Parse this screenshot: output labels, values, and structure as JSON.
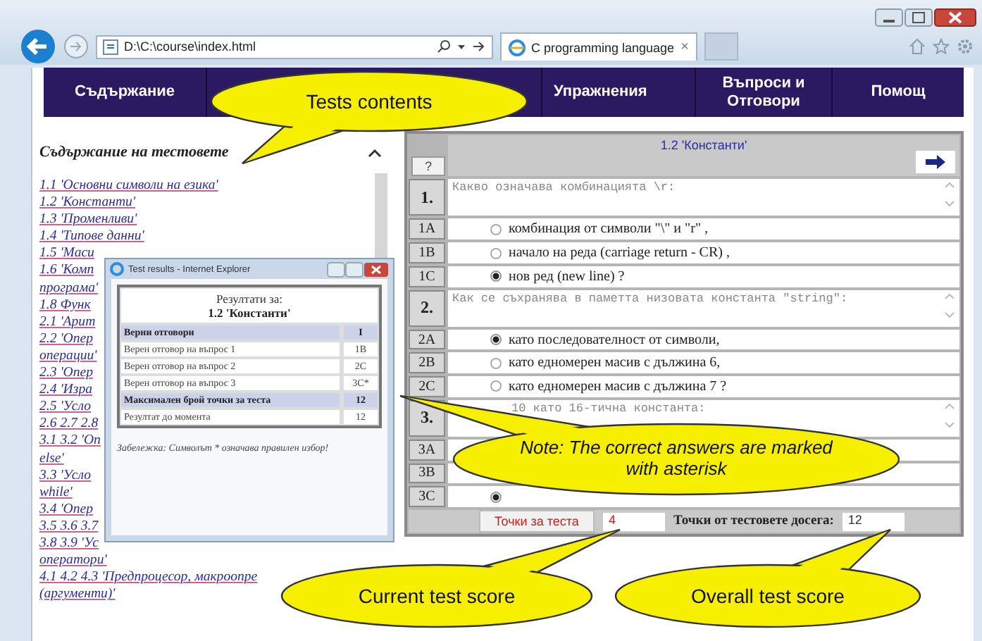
{
  "browser": {
    "address": "D:\\C:\\course\\index.html",
    "tab_title": "C programming language",
    "tab_close": "×"
  },
  "nav": {
    "items": [
      {
        "label": "Съдържание"
      },
      {
        "label": "Упражнения"
      },
      {
        "label": "Въпроси и Отговори"
      },
      {
        "label": "Помощ"
      }
    ]
  },
  "contents": {
    "heading": "Съдържание на тестовете",
    "links": [
      {
        "lines": [
          "1.1 'Основни символи на езика'"
        ]
      },
      {
        "lines": [
          "1.2 'Константи'"
        ]
      },
      {
        "lines": [
          "1.3 'Променливи'"
        ]
      },
      {
        "lines": [
          "1.4 'Типове данни'"
        ]
      },
      {
        "lines": [
          "1.5 'Маси"
        ]
      },
      {
        "lines": [
          "1.6 'Комп",
          "програма'"
        ]
      },
      {
        "lines": [
          "1.8 Функ"
        ]
      },
      {
        "lines": [
          "2.1 'Арит"
        ]
      },
      {
        "lines": [
          "2.2 'Опер",
          "операции'"
        ]
      },
      {
        "lines": [
          "2.3 'Опер"
        ]
      },
      {
        "lines": [
          "2.4 'Изра"
        ]
      },
      {
        "lines": [
          "2.5 'Усло"
        ]
      },
      {
        "lines": [
          "2.6 2.7 2.8"
        ]
      },
      {
        "lines": [
          "3.1 3.2 'Оп",
          "else'"
        ]
      },
      {
        "lines": [
          "3.3 'Усло",
          "while'"
        ]
      },
      {
        "lines": [
          "3.4 'Опер"
        ]
      },
      {
        "lines": [
          "3.5 3.6 3.7"
        ]
      },
      {
        "lines": [
          "3.8 3.9 'Ус",
          "оператори'"
        ]
      },
      {
        "lines": [
          "4.1 4.2 4.3 'Предпроцесор, макроопре",
          "(аргументи)'"
        ]
      }
    ]
  },
  "quiz": {
    "help": "?",
    "title": "1.2 'Константи'",
    "questions": [
      {
        "number": "1.",
        "text": "Какво означава комбинацията \\r:",
        "options": [
          {
            "code": "1A",
            "label": "комбинация от символи \"\\\" и \"r\" ,",
            "selected": false
          },
          {
            "code": "1B",
            "label": "начало на реда (carriage return - CR) ,",
            "selected": false
          },
          {
            "code": "1C",
            "label": "нов ред (new line) ?",
            "selected": true
          }
        ]
      },
      {
        "number": "2.",
        "text": "Как се съхранява в паметта низовата константа \"string\":",
        "options": [
          {
            "code": "2A",
            "label": "като последователност от символи,",
            "selected": true
          },
          {
            "code": "2B",
            "label": "като едномерен масив с дължина 6,",
            "selected": false
          },
          {
            "code": "2C",
            "label": "като едномерен масив с дължина 7 ?",
            "selected": false
          }
        ]
      },
      {
        "number": "3.",
        "text": "10 като 16-тична константа:",
        "options": [
          {
            "code": "3A"
          },
          {
            "code": "3B"
          },
          {
            "code": "3C",
            "selected": true
          }
        ]
      }
    ],
    "footer": {
      "score_button": "Точки за теста",
      "score_value": "4",
      "total_label": "Точки от тестовете досега:",
      "total_value": "12"
    }
  },
  "results_popup": {
    "title": "Test results - Internet Explorer",
    "heading": "Резултати за:",
    "subheading": "1.2 'Константи'",
    "rows": [
      {
        "kind": "summary",
        "label": "Верни отговори",
        "value": "I"
      },
      {
        "kind": "item",
        "label": "Верен отговор на въпрос 1",
        "value": "1B"
      },
      {
        "kind": "item",
        "label": "Верен отговор на въпрос 2",
        "value": "2C"
      },
      {
        "kind": "item",
        "label": "Верен отговор на въпрос 3",
        "value": "3C*"
      },
      {
        "kind": "summary",
        "label": "Максимален брой точки за теста",
        "value": "12"
      },
      {
        "kind": "item",
        "label": "Резултат до момента",
        "value": "12"
      }
    ],
    "note": "Забележка: Символът * означава правилен избор!"
  },
  "callouts": [
    {
      "text": "Tests contents",
      "italic": false
    },
    {
      "text": "Note: The correct answers are marked with asterisk",
      "italic": true
    },
    {
      "text": "Current test score",
      "italic": false
    },
    {
      "text": "Overall test score",
      "italic": false
    }
  ]
}
